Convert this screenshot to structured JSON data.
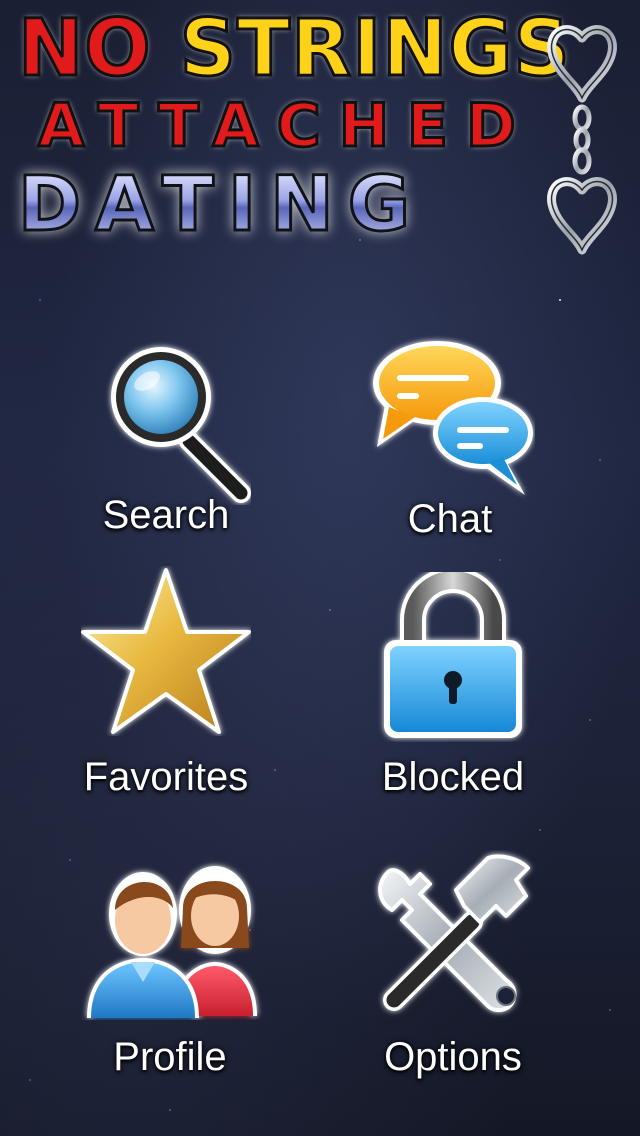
{
  "logo": {
    "line1_word1": "NO",
    "line1_word2": "STRINGS",
    "line2": "ATTACHED",
    "line3": "DATING"
  },
  "menu": {
    "search": {
      "label": "Search",
      "icon": "magnifier-icon"
    },
    "chat": {
      "label": "Chat",
      "icon": "chat-bubbles-icon"
    },
    "favorites": {
      "label": "Favorites",
      "icon": "star-icon"
    },
    "blocked": {
      "label": "Blocked",
      "icon": "padlock-icon"
    },
    "profile": {
      "label": "Profile",
      "icon": "people-icon"
    },
    "options": {
      "label": "Options",
      "icon": "tools-icon"
    }
  },
  "colors": {
    "logo_red": "#e11b1b",
    "logo_yellow": "#ffd21a",
    "logo_blue": "#7a86d6",
    "label_text": "#ffffff",
    "background": "#1e2338"
  }
}
